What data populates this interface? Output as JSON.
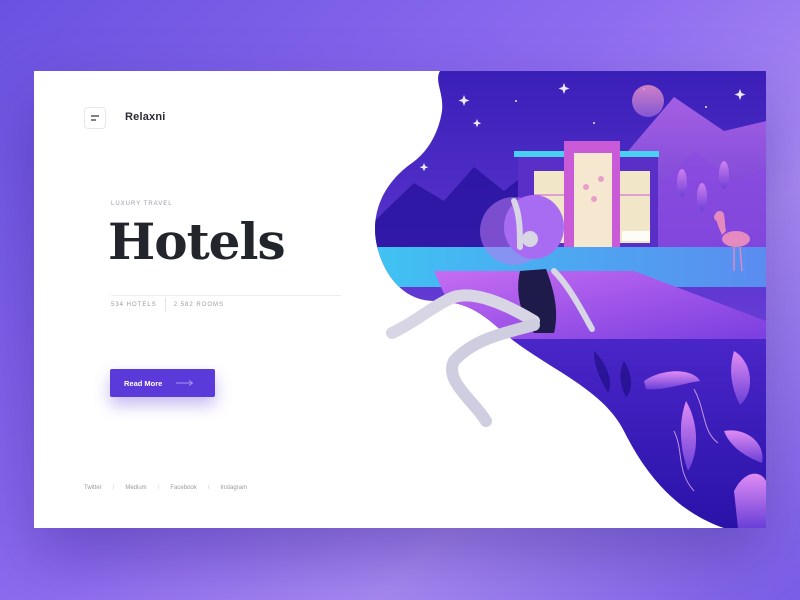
{
  "brand": {
    "name": "Relaxni"
  },
  "hero": {
    "eyebrow": "LUXURY TRAVEL",
    "title": "Hotels",
    "stats": [
      "534 HOTELS",
      "2 582 ROOMS"
    ],
    "cta_label": "Read More"
  },
  "social": {
    "links": [
      "Twitter",
      "Medium",
      "Facebook",
      "Instagram"
    ],
    "separator": "/"
  },
  "icons": {
    "menu": "menu-icon",
    "arrow": "arrow-right-icon"
  },
  "colors": {
    "accent": "#5b3ad9",
    "title": "#23252d",
    "muted": "#9a9aa6",
    "background": "#7a5ee8"
  }
}
